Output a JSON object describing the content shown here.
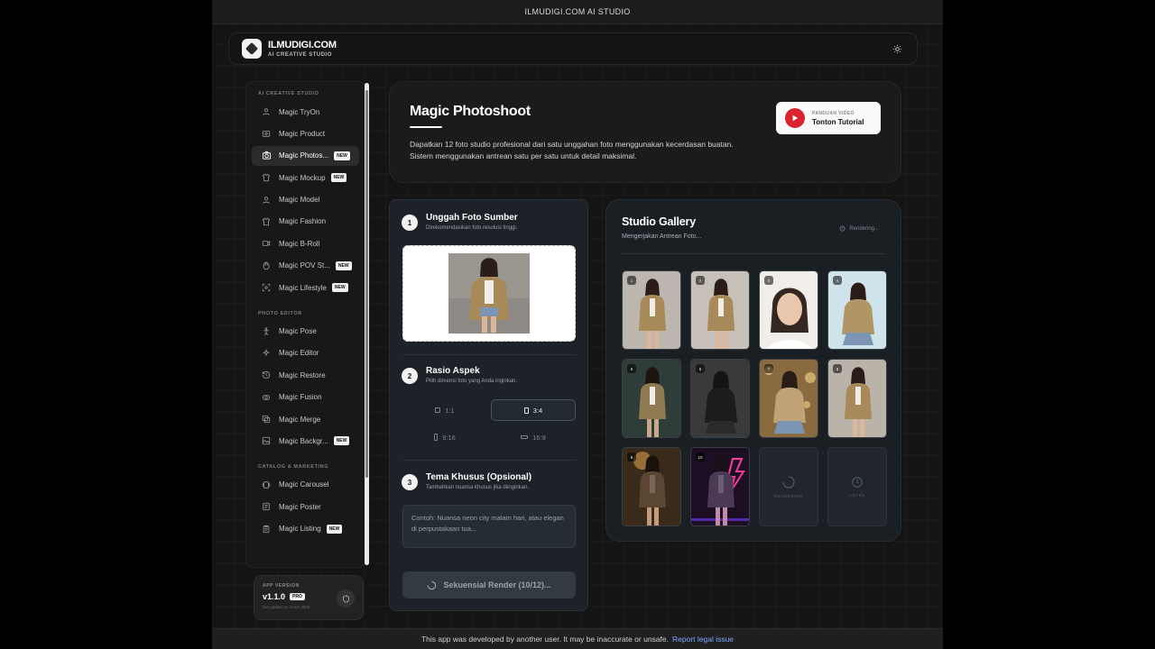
{
  "topbar": {
    "title": "ILMUDIGI.COM AI STUDIO"
  },
  "header": {
    "brand": "ILMUDIGI.COM",
    "tagline": "AI CREATIVE STUDIO"
  },
  "sidebar": {
    "sections": [
      {
        "title": "AI CREATIVE STUDIO",
        "items": [
          {
            "label": "Magic TryOn",
            "icon": "user-icon",
            "new": false,
            "active": false
          },
          {
            "label": "Magic Product",
            "icon": "box-icon",
            "new": false,
            "active": false
          },
          {
            "label": "Magic Photos...",
            "icon": "camera-icon",
            "new": true,
            "active": true
          },
          {
            "label": "Magic Mockup",
            "icon": "shirt-icon",
            "new": true,
            "active": false
          },
          {
            "label": "Magic Model",
            "icon": "user-icon",
            "new": false,
            "active": false
          },
          {
            "label": "Magic Fashion",
            "icon": "shirt-icon",
            "new": false,
            "active": false
          },
          {
            "label": "Magic B-Roll",
            "icon": "video-icon",
            "new": false,
            "active": false
          },
          {
            "label": "Magic POV St...",
            "icon": "hand-icon",
            "new": true,
            "active": false
          },
          {
            "label": "Magic Lifestyle",
            "icon": "frame-icon",
            "new": true,
            "active": false
          }
        ]
      },
      {
        "title": "PHOTO EDITOR",
        "items": [
          {
            "label": "Magic Pose",
            "icon": "figure-icon",
            "new": false,
            "active": false
          },
          {
            "label": "Magic Editor",
            "icon": "sparkles-icon",
            "new": false,
            "active": false
          },
          {
            "label": "Magic Restore",
            "icon": "history-icon",
            "new": false,
            "active": false
          },
          {
            "label": "Magic Fusion",
            "icon": "merge-icon",
            "new": false,
            "active": false
          },
          {
            "label": "Magic Merge",
            "icon": "layers-icon",
            "new": false,
            "active": false
          },
          {
            "label": "Magic Backgr...",
            "icon": "image-icon",
            "new": true,
            "active": false
          }
        ]
      },
      {
        "title": "CATALOG & MARKETING",
        "items": [
          {
            "label": "Magic Carousel",
            "icon": "carousel-icon",
            "new": false,
            "active": false
          },
          {
            "label": "Magic Poster",
            "icon": "poster-icon",
            "new": false,
            "active": false
          },
          {
            "label": "Magic Listing",
            "icon": "clipboard-icon",
            "new": true,
            "active": false
          }
        ]
      }
    ],
    "new_badge": "NEW",
    "app_version": {
      "label": "APP VERSION",
      "version": "v1.1.0",
      "tier": "PRO",
      "updated": "last update 31 maret 2026"
    }
  },
  "hero": {
    "title": "Magic Photoshoot",
    "description": "Dapatkan 12 foto studio profesional dari satu unggahan foto menggunakan kecerdasan buatan. Sistem menggunakan antrean satu per satu untuk detail maksimal.",
    "video_label": "PANDUAN VIDEO",
    "video_title": "Tonton Tutorial"
  },
  "form": {
    "step1": {
      "num": "1",
      "title": "Unggah Foto Sumber",
      "sub": "Direkomendasikan foto resolusi tinggi."
    },
    "step2": {
      "num": "2",
      "title": "Rasio Aspek",
      "sub": "Pilih dimensi foto yang Anda inginkan."
    },
    "ratios": [
      {
        "label": "1:1",
        "selected": false
      },
      {
        "label": "3:4",
        "selected": true
      },
      {
        "label": "9:16",
        "selected": false
      },
      {
        "label": "16:9",
        "selected": false
      }
    ],
    "step3": {
      "num": "3",
      "title": "Tema Khusus (Opsional)",
      "sub": "Tambahkan nuansa khusus jika diinginkan."
    },
    "theme_placeholder": "Contoh: Nuansa neon city malam hari, atau elegan di perpustakaan tua...",
    "render_button": "Sekuensial Render (10/12)..."
  },
  "gallery": {
    "title": "Studio Gallery",
    "subtitle": "Mengerjakan Antrean Foto...",
    "status": "Rendering...",
    "tiles": [
      {
        "num": "1"
      },
      {
        "num": "2"
      },
      {
        "num": "3"
      },
      {
        "num": "4"
      },
      {
        "num": "5"
      },
      {
        "num": "6"
      },
      {
        "num": "7"
      },
      {
        "num": "8"
      },
      {
        "num": "9"
      },
      {
        "num": "10"
      }
    ],
    "placeholder_rendering": "RENDERING",
    "placeholder_queue": "ANTRE"
  },
  "footer": {
    "text": "This app was developed by another user. It may be inaccurate or unsafe.",
    "link": "Report legal issue"
  },
  "colors": {
    "accent": "#ffffff",
    "play_red": "#d9232e",
    "panel": "#1c2227"
  }
}
